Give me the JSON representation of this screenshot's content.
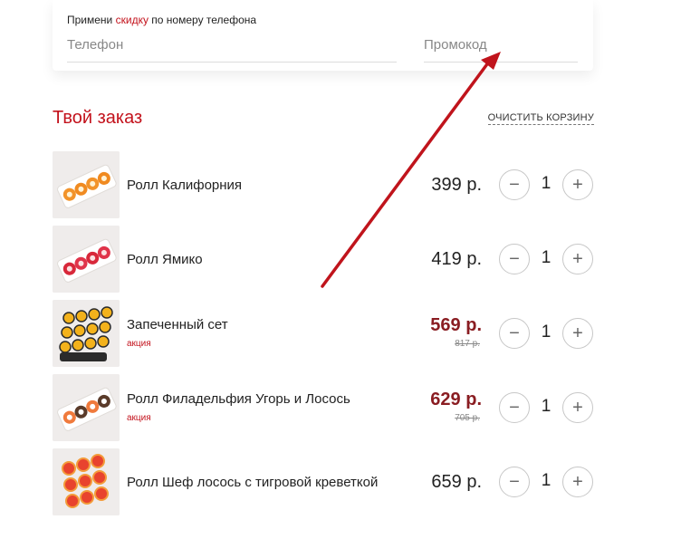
{
  "promo": {
    "hint_prefix": "Примени",
    "hint_link": "скидку",
    "hint_suffix": "по номеру телефона",
    "phone_placeholder": "Телефон",
    "promo_placeholder": "Промокод"
  },
  "order": {
    "title": "Твой заказ",
    "clear_label": "ОЧИСТИТЬ КОРЗИНУ",
    "items": [
      {
        "name": "Ролл Калифорния",
        "price": "399 р.",
        "qty": "1"
      },
      {
        "name": "Ролл Ямико",
        "price": "419 р.",
        "qty": "1"
      },
      {
        "name": "Запеченный сет",
        "tag": "акция",
        "price": "569 р.",
        "old_price": "817 р.",
        "qty": "1"
      },
      {
        "name": "Ролл Филадельфия Угорь и Лосось",
        "tag": "акция",
        "price": "629 р.",
        "old_price": "705 р.",
        "qty": "1"
      },
      {
        "name": "Ролл Шеф лосось с тигровой креветкой",
        "price": "659 р.",
        "qty": "1"
      }
    ],
    "minus_symbol": "−",
    "plus_symbol": "+"
  },
  "colors": {
    "accent": "#c3121c",
    "sale_price": "#8a1d22",
    "arrow": "#c0141c"
  }
}
